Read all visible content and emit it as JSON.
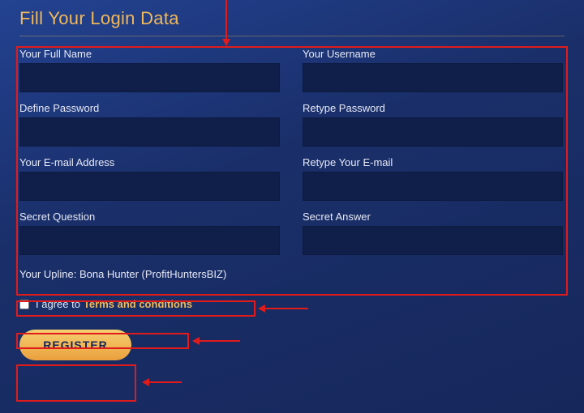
{
  "title": "Fill Your Login Data",
  "fields": {
    "full_name": {
      "label": "Your Full Name",
      "value": ""
    },
    "username": {
      "label": "Your Username",
      "value": ""
    },
    "password": {
      "label": "Define Password",
      "value": ""
    },
    "password2": {
      "label": "Retype Password",
      "value": ""
    },
    "email": {
      "label": "Your E-mail Address",
      "value": ""
    },
    "email2": {
      "label": "Retype Your E-mail",
      "value": ""
    },
    "secret_q": {
      "label": "Secret Question",
      "value": ""
    },
    "secret_a": {
      "label": "Secret Answer",
      "value": ""
    }
  },
  "upline": "Your Upline: Bona Hunter (ProfitHuntersBIZ)",
  "agree_prefix": "I agree to ",
  "agree_link": "Terms and conditions",
  "register_label": "REGISTER"
}
